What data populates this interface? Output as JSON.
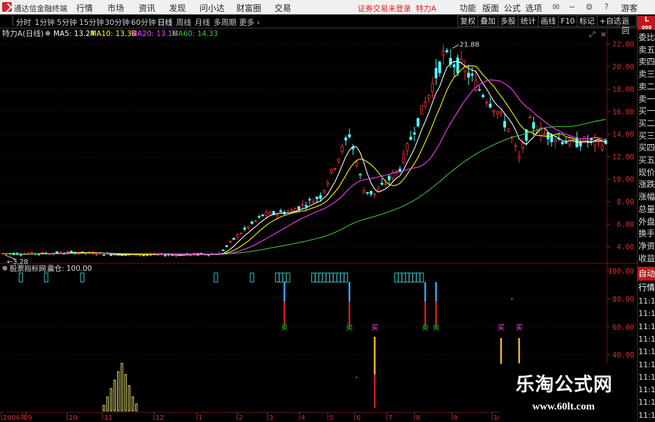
{
  "menubar": {
    "app_title": "通达信金融终端",
    "menus": [
      "行情",
      "市场",
      "资讯",
      "发现",
      "问小达",
      "财富圈",
      "交易"
    ],
    "warning": "证券交易未登录",
    "stock_name": "特力A",
    "right_items": [
      "功能",
      "版面",
      "公式",
      "选项"
    ],
    "guest": "游客"
  },
  "toolbar": {
    "periods": [
      "分时",
      "1分钟",
      "5分钟",
      "15分钟",
      "30分钟",
      "60分钟",
      "日线",
      "周线",
      "月线",
      "多周期",
      "更多"
    ],
    "active_period": "日线",
    "right_buttons": [
      "复权",
      "叠加",
      "多股",
      "统计",
      "画线",
      "F10",
      "标记",
      "+自选",
      "返回"
    ]
  },
  "sidepanel": {
    "tag_top": "L",
    "tag_sub": "000",
    "items": [
      "委比",
      "卖五",
      "卖四",
      "卖三",
      "卖二",
      "卖一",
      "买一",
      "买二",
      "买三",
      "买四",
      "买五",
      "现价",
      "涨跌",
      "涨幅",
      "总量",
      "外盘",
      "换手",
      "净资",
      "收益"
    ],
    "auto_label": "自动",
    "market_label": "行情",
    "times": [
      "11:1",
      "11:1",
      "11:1",
      "11:1",
      "11:1",
      "11:1",
      "11:1",
      "11:1",
      "11:1",
      "11:1"
    ]
  },
  "chart_data": [
    {
      "type": "candlestick",
      "title": "特力A(日线)",
      "indicators": [
        {
          "name": "MA5",
          "value": "13.24",
          "color": "#ffffff"
        },
        {
          "name": "MA10",
          "value": "13.38",
          "color": "#ffff00"
        },
        {
          "name": "MA20",
          "value": "13.16",
          "color": "#ff40ff"
        },
        {
          "name": "MA60",
          "value": "14.33",
          "color": "#40c040"
        }
      ],
      "ylim": [
        2.6,
        22.9
      ],
      "y_ticks": [
        "22.00",
        "20.00",
        "18.00",
        "16.00",
        "14.00",
        "12.00",
        "10.00",
        "8.00",
        "6.00",
        "4.00"
      ],
      "annotations": [
        {
          "label": "21.88",
          "kind": "high",
          "x_index": 124,
          "value": 21.88
        },
        {
          "label": "3.28",
          "kind": "low",
          "x_index": 0,
          "value": 3.28
        }
      ],
      "price_path": [
        [
          0,
          3.4
        ],
        [
          10,
          3.4
        ],
        [
          20,
          3.5
        ],
        [
          30,
          3.35
        ],
        [
          40,
          3.3
        ],
        [
          50,
          3.3
        ],
        [
          60,
          3.4
        ],
        [
          65,
          5.0
        ],
        [
          72,
          6.8
        ],
        [
          80,
          7.2
        ],
        [
          88,
          8.5
        ],
        [
          96,
          14.0
        ],
        [
          100,
          9.0
        ],
        [
          103,
          8.7
        ],
        [
          110,
          11.0
        ],
        [
          114,
          14.5
        ],
        [
          118,
          17.5
        ],
        [
          122,
          21.0
        ],
        [
          124,
          20.5
        ],
        [
          128,
          19.8
        ],
        [
          132,
          18.0
        ],
        [
          136,
          16.5
        ],
        [
          140,
          14.5
        ],
        [
          143,
          11.8
        ],
        [
          146,
          15.0
        ],
        [
          150,
          14.0
        ],
        [
          154,
          13.6
        ],
        [
          158,
          13.2
        ],
        [
          162,
          13.4
        ],
        [
          166,
          13.1
        ]
      ]
    },
    {
      "type": "signal_indicator",
      "title": "股票指标网",
      "subtitle_label": "震仓",
      "subtitle_value": "100.00",
      "ylim": [
        0,
        100
      ],
      "y_ticks": [
        "100.00",
        "80.00",
        "60.00",
        "40.00"
      ],
      "x_axis_labels": [
        "2006年",
        "9",
        "10",
        "11",
        "12",
        "1",
        "2",
        "3",
        "4",
        "5",
        "6",
        "7",
        "8",
        "9",
        "10"
      ],
      "sell_label": "卖",
      "buy_label": "买",
      "signals": [
        {
          "type": "sell",
          "x_index": 78
        },
        {
          "type": "sell",
          "x_index": 96
        },
        {
          "type": "buy",
          "x_index": 103
        },
        {
          "type": "sell",
          "x_index": 117
        },
        {
          "type": "sell",
          "x_index": 120
        },
        {
          "type": "buy",
          "x_index": 138
        },
        {
          "type": "buy",
          "x_index": 143
        }
      ],
      "box_clusters": [
        {
          "start": 5,
          "count": 1
        },
        {
          "start": 12,
          "count": 1
        },
        {
          "start": 22,
          "count": 1
        },
        {
          "start": 59,
          "count": 1
        },
        {
          "start": 69,
          "count": 1
        },
        {
          "start": 76,
          "count": 4
        },
        {
          "start": 86,
          "count": 10
        },
        {
          "start": 109,
          "count": 8
        }
      ],
      "red_bars": [
        {
          "x_index": 78,
          "top": 78,
          "bottom": 62
        },
        {
          "x_index": 96,
          "top": 78,
          "bottom": 62
        },
        {
          "x_index": 117,
          "top": 78,
          "bottom": 62
        },
        {
          "x_index": 120,
          "top": 78,
          "bottom": 62
        },
        {
          "x_index": 103,
          "top": 26,
          "bottom": 2
        }
      ],
      "yellow_bars": [
        {
          "x_index": 103,
          "top": 53,
          "bottom": 26
        },
        {
          "x_index": 138,
          "top": 52,
          "bottom": 30
        },
        {
          "x_index": 143,
          "top": 52,
          "bottom": 34
        }
      ],
      "low_spikes": [
        [
          28,
          4
        ],
        [
          29,
          10
        ],
        [
          30,
          16
        ],
        [
          31,
          22
        ],
        [
          32,
          28
        ],
        [
          33,
          34
        ],
        [
          34,
          26
        ],
        [
          35,
          18
        ],
        [
          36,
          10
        ],
        [
          37,
          5
        ]
      ]
    }
  ],
  "watermark": {
    "title": "乐淘公式网",
    "url": "www.60lt.com"
  }
}
